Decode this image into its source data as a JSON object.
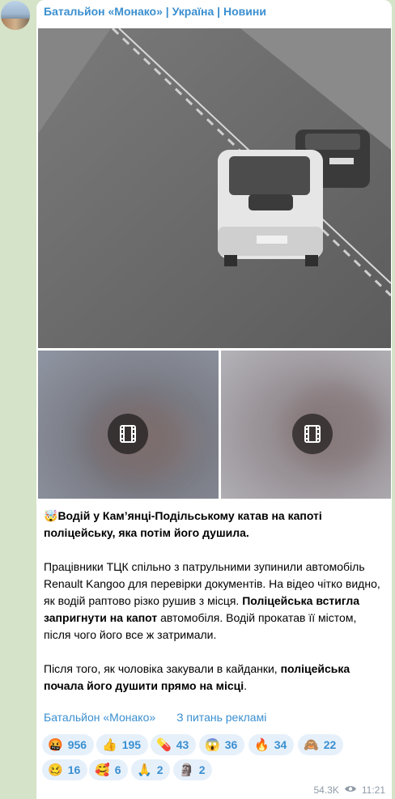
{
  "channel": {
    "name": "Батальйон «Монако» | Україна | Новини"
  },
  "post": {
    "title_emoji": "🤯",
    "title": "Водій у Кам’янці-Подільському катав на капоті поліцейську, яка потім його душила.",
    "p2_a": "Працівники ТЦК спільно з патрульними зупинили автомобіль Renault Kangoo для перевірки документів. На відео чітко видно, як водій раптово різко рушив з місця. ",
    "p2_b": "Поліцейська встигла запригнути на капот",
    "p2_c": " автомобіля. Водій прокатав її містом, після чого його все ж затримали.",
    "p3_a": "Після того, як чоловіка закували в кайданки, ",
    "p3_b": "поліцейська почала його душити прямо на місці",
    "p3_c": "."
  },
  "links": {
    "channel": "Батальйон «Монако»",
    "ads": "З питань рекламі"
  },
  "reactions": [
    {
      "emoji": "🤬",
      "count": "956"
    },
    {
      "emoji": "👍",
      "count": "195"
    },
    {
      "emoji": "💊",
      "count": "43"
    },
    {
      "emoji": "😱",
      "count": "36"
    },
    {
      "emoji": "🔥",
      "count": "34"
    },
    {
      "emoji": "🙈",
      "count": "22"
    },
    {
      "emoji": "🥴",
      "count": "16"
    },
    {
      "emoji": "🥰",
      "count": "6"
    },
    {
      "emoji": "🙏",
      "count": "2"
    },
    {
      "emoji": "🗿",
      "count": "2"
    }
  ],
  "meta": {
    "views": "54.3K",
    "time": "11:21",
    "views_icon": "eye-icon"
  },
  "media": {
    "video_icon": "film-icon"
  }
}
